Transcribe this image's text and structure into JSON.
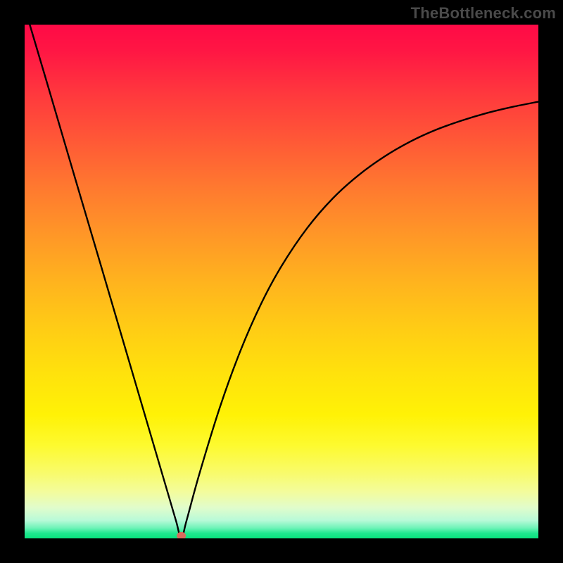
{
  "watermark": "TheBottleneck.com",
  "chart_data": {
    "type": "line",
    "title": "",
    "xlabel": "",
    "ylabel": "",
    "xlim": [
      0,
      100
    ],
    "ylim": [
      0,
      100
    ],
    "grid": false,
    "legend": false,
    "notes": "Bottleneck-style curve on rainbow gradient background. V-shaped curve with minimum near x≈30.5 reaching y≈0; left branch nearly linear, right branch asymptotic toward ~85.",
    "series": [
      {
        "name": "bottleneck-curve",
        "x": [
          1,
          5,
          10,
          15,
          20,
          25,
          28,
          29.5,
          30.5,
          31.5,
          34,
          38,
          42,
          46,
          50,
          55,
          60,
          65,
          70,
          75,
          80,
          85,
          90,
          95,
          100
        ],
        "y": [
          100,
          86.5,
          69.5,
          52.6,
          35.6,
          18.6,
          8.4,
          3.3,
          0.0,
          3.4,
          12.5,
          25.5,
          36.5,
          45.6,
          53.0,
          60.4,
          66.2,
          70.7,
          74.3,
          77.2,
          79.5,
          81.3,
          82.8,
          84.0,
          85.0
        ]
      }
    ],
    "marker": {
      "x": 30.5,
      "y": 0.5,
      "color": "#d96b5e"
    },
    "background_gradient_stops": [
      {
        "pct": 0,
        "color": "#ff0a46"
      },
      {
        "pct": 50,
        "color": "#ffb31e"
      },
      {
        "pct": 76,
        "color": "#fff206"
      },
      {
        "pct": 100,
        "color": "#09e27e"
      }
    ]
  }
}
